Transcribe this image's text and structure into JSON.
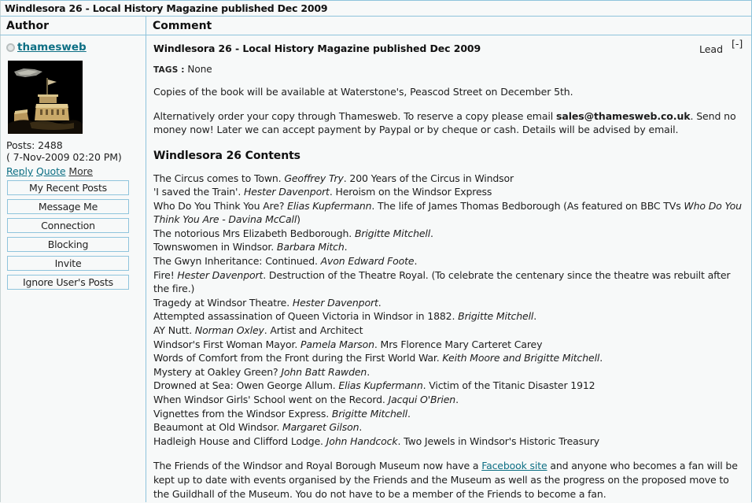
{
  "window": {
    "title": "Windlesora 26 - Local History Magazine published Dec 2009"
  },
  "table_headers": {
    "author": "Author",
    "comment": "Comment"
  },
  "author": {
    "badge_icon": "user-status-icon",
    "username": "thamesweb",
    "avatar_alt": "windsor-castle-night-avatar",
    "posts": "Posts: 2488",
    "date": "( 7-Nov-2009 02:20 PM)",
    "links": [
      {
        "label": "Reply",
        "style": "link"
      },
      {
        "label": "Quote",
        "style": "link"
      },
      {
        "label": "More",
        "style": "dark"
      }
    ],
    "buttons": [
      "My Recent Posts",
      "Message Me",
      "Connection",
      "Blocking",
      "Invite",
      "Ignore User's Posts"
    ]
  },
  "post": {
    "subject": "Windlesora 26 - Local History Magazine published Dec 2009",
    "lead_label": "Lead",
    "collapse_label": "[-]",
    "tags_label": "TAGS :",
    "tags_value": "None",
    "paragraph1": "Copies of the book will be available at Waterstone's, Peascod Street on December 5th.",
    "paragraph2_pre": "Alternatively order your copy through Thamesweb. To reserve a copy please email ",
    "paragraph2_email": "sales@thamesweb.co.uk",
    "paragraph2_post": ". Send no money now! Later we can accept payment by Paypal or by cheque or cash. Details will be advised by email.",
    "contents_heading": "Windlesora 26 Contents",
    "contents": [
      {
        "pre": "The Circus comes to Town. ",
        "author": "Geoffrey Try",
        "post": ". 200 Years of the Circus in Windsor"
      },
      {
        "pre": "'I saved the Train'. ",
        "author": "Hester Davenport",
        "post": ". Heroism on the Windsor Express"
      },
      {
        "pre": "Who Do You Think You Are? ",
        "author": "Elias Kupfermann",
        "post": ". The life of James Thomas Bedborough (As featured on BBC TVs ",
        "author2": "Who Do You Think You Are - Davina McCall",
        "post2": ")"
      },
      {
        "pre": "The notorious Mrs Elizabeth Bedborough. ",
        "author": "Brigitte Mitchell",
        "post": "."
      },
      {
        "pre": "Townswomen in Windsor. ",
        "author": "Barbara Mitch",
        "post": "."
      },
      {
        "pre": "The Gwyn Inheritance: Continued. ",
        "author": "Avon Edward Foote",
        "post": "."
      },
      {
        "pre": "Fire! ",
        "author": "Hester Davenport",
        "post": ". Destruction of the Theatre Royal. (To celebrate the centenary since the theatre was rebuilt after the fire.)"
      },
      {
        "pre": "Tragedy at Windsor Theatre. ",
        "author": "Hester Davenport",
        "post": "."
      },
      {
        "pre": "Attempted assassination of Queen Victoria in Windsor in 1882. ",
        "author": "Brigitte Mitchell",
        "post": "."
      },
      {
        "pre": "AY Nutt. ",
        "author": "Norman Oxley",
        "post": ". Artist and Architect"
      },
      {
        "pre": "Windsor's First Woman Mayor. ",
        "author": "Pamela Marson",
        "post": ". Mrs Florence Mary Carteret Carey"
      },
      {
        "pre": "Words of Comfort from the Front during the First World War. ",
        "author": "Keith Moore and Brigitte Mitchell",
        "post": "."
      },
      {
        "pre": "Mystery at Oakley Green? ",
        "author": "John Batt Rawden",
        "post": "."
      },
      {
        "pre": "Drowned at Sea: Owen George Allum. ",
        "author": "Elias Kupfermann",
        "post": ". Victim of the Titanic Disaster 1912"
      },
      {
        "pre": "When Windsor Girls' School went on the Record. ",
        "author": "Jacqui O'Brien",
        "post": "."
      },
      {
        "pre": "Vignettes from the Windsor Express. ",
        "author": "Brigitte Mitchell",
        "post": "."
      },
      {
        "pre": "Beaumont at Old Windsor. ",
        "author": "Margaret Gilson",
        "post": "."
      },
      {
        "pre": "Hadleigh House and Clifford Lodge. ",
        "author": "John Handcock",
        "post": ". Two Jewels in Windsor's Historic Treasury"
      }
    ],
    "closing_pre": "The Friends of the Windsor and Royal Borough Museum now have a ",
    "closing_link": "Facebook site",
    "closing_post": " and anyone who becomes a fan will be kept up to date with events organised by the Friends and the Museum as well as the progress on the proposed move to the Guildhall of the Museum. You do not have to be a member of the Friends to become a fan."
  },
  "colors": {
    "border": "#8fc4dc",
    "link": "#0d6f84",
    "background": "#f7f9f9"
  }
}
